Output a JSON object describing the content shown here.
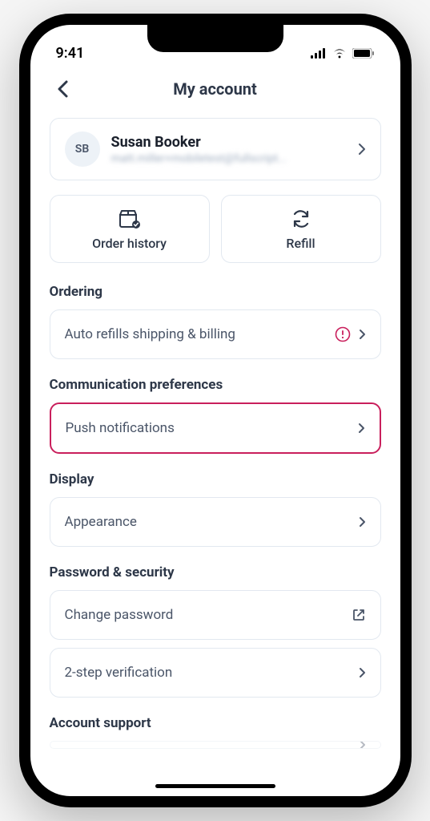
{
  "status": {
    "time": "9:41"
  },
  "header": {
    "title": "My account"
  },
  "profile": {
    "initials": "SB",
    "name": "Susan Booker",
    "email": "matt.miller+mobiletest@fullscript..."
  },
  "actions": {
    "order_history": "Order history",
    "refill": "Refill"
  },
  "sections": {
    "ordering": {
      "heading": "Ordering",
      "auto_refills": "Auto refills shipping & billing"
    },
    "communication": {
      "heading": "Communication preferences",
      "push": "Push notifications"
    },
    "display": {
      "heading": "Display",
      "appearance": "Appearance"
    },
    "security": {
      "heading": "Password & security",
      "change_password": "Change password",
      "two_step": "2-step verification"
    },
    "support": {
      "heading": "Account support"
    }
  }
}
